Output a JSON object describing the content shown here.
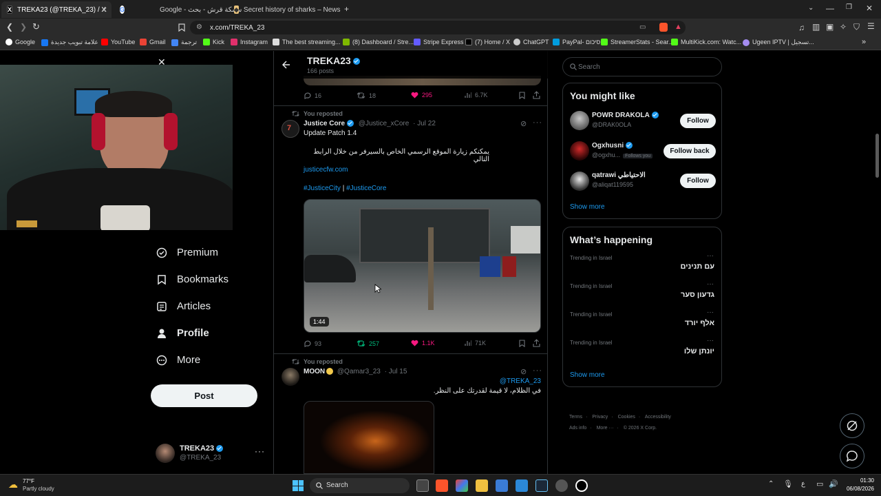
{
  "browser": {
    "tabs": [
      {
        "title": "TREKA23 (@TREKA_23) / X",
        "active": true
      },
      {
        "title": "Google - سمكة قرش - بحث",
        "active": false
      },
      {
        "title": "Secret history of sharks – News",
        "active": false
      }
    ],
    "url": "x.com/TREKA_23",
    "bookmarks": [
      "Google",
      "علامة تبويب جديدة",
      "YouTube",
      "Gmail",
      "ترجمة",
      "Kick",
      "Instagram",
      "The best streaming...",
      "(8) Dashboard / Stre...",
      "Stripe Express",
      "(7) Home / X",
      "ChatGPT",
      "PayPal- סיכום",
      "StreamerStats - Sear...",
      "MultiKick.com: Watc...",
      "Ugeen IPTV | تسجيل..."
    ]
  },
  "sidebar": {
    "items": [
      {
        "label": "Premium",
        "icon": "premium-icon"
      },
      {
        "label": "Bookmarks",
        "icon": "bookmark-icon"
      },
      {
        "label": "Articles",
        "icon": "articles-icon"
      },
      {
        "label": "Profile",
        "icon": "profile-icon"
      },
      {
        "label": "More",
        "icon": "more-icon"
      }
    ],
    "post_label": "Post",
    "account": {
      "name": "TREKA23",
      "handle": "@TREKA_23"
    }
  },
  "profile_header": {
    "name": "TREKA23",
    "posts": "166 posts"
  },
  "prev_tweet_actions": {
    "replies": "16",
    "reposts": "18",
    "likes": "295",
    "views": "6.7K"
  },
  "tweet1": {
    "reposted": "You reposted",
    "name": "Justice Core",
    "handle": "@Justice_xCore",
    "date": "· Jul 22",
    "line1": "Update Patch 1.4",
    "arabic": "يمكنكم زيارة الموقع الرسمي الخاص بالسيرفر من خلال الرابط التالي",
    "link": "justicecfw.com",
    "tag1": "#JusticeCity",
    "sep": "|",
    "tag2": "#JusticeCore",
    "duration": "1:44",
    "replies": "93",
    "reposts": "257",
    "likes": "1.1K",
    "views": "71K"
  },
  "tweet2": {
    "reposted": "You reposted",
    "name": "MOON",
    "handle": "@Qamar3_23",
    "date": "· Jul 15",
    "mention": "@TREKA_23",
    "arabic": "في الظلام، لا قيمة لقدرتك على النظر."
  },
  "right": {
    "search_placeholder": "Search",
    "you_might_like": "You might like",
    "suggestions": [
      {
        "name": "POWR DRAKOLA",
        "handle": "@DRAK0OLA",
        "button": "Follow",
        "follows_you": ""
      },
      {
        "name": "Ogxhusni",
        "handle": "@ogxhu...",
        "button": "Follow back",
        "follows_you": "Follows you"
      },
      {
        "name": "qatrawi الاحتياطي",
        "handle": "@aliqat119595",
        "button": "Follow",
        "follows_you": ""
      }
    ],
    "show_more": "Show more",
    "whats_happening": "What’s happening",
    "trends": [
      {
        "context": "Trending in Israel",
        "topic": "עם תנינים"
      },
      {
        "context": "Trending in Israel",
        "topic": "גדעון סער"
      },
      {
        "context": "Trending in Israel",
        "topic": "אלף יורד"
      },
      {
        "context": "Trending in Israel",
        "topic": "יונתן שלו"
      }
    ],
    "show_more2": "Show more",
    "footer1": [
      "Terms",
      "Privacy",
      "Cookies",
      "Accessibility"
    ],
    "footer2": [
      "Ads info",
      "More ···",
      "© 2026 X Corp."
    ]
  },
  "taskbar": {
    "weather_temp": "77°F",
    "weather_desc": "Partly cloudy",
    "search": "Search",
    "lang": "ع",
    "time": "01:30",
    "date": "06/08/2026"
  },
  "colors": {
    "accent": "#1d9bf0",
    "like": "#f91880",
    "repost": "#00ba7c",
    "bg": "#000000"
  }
}
